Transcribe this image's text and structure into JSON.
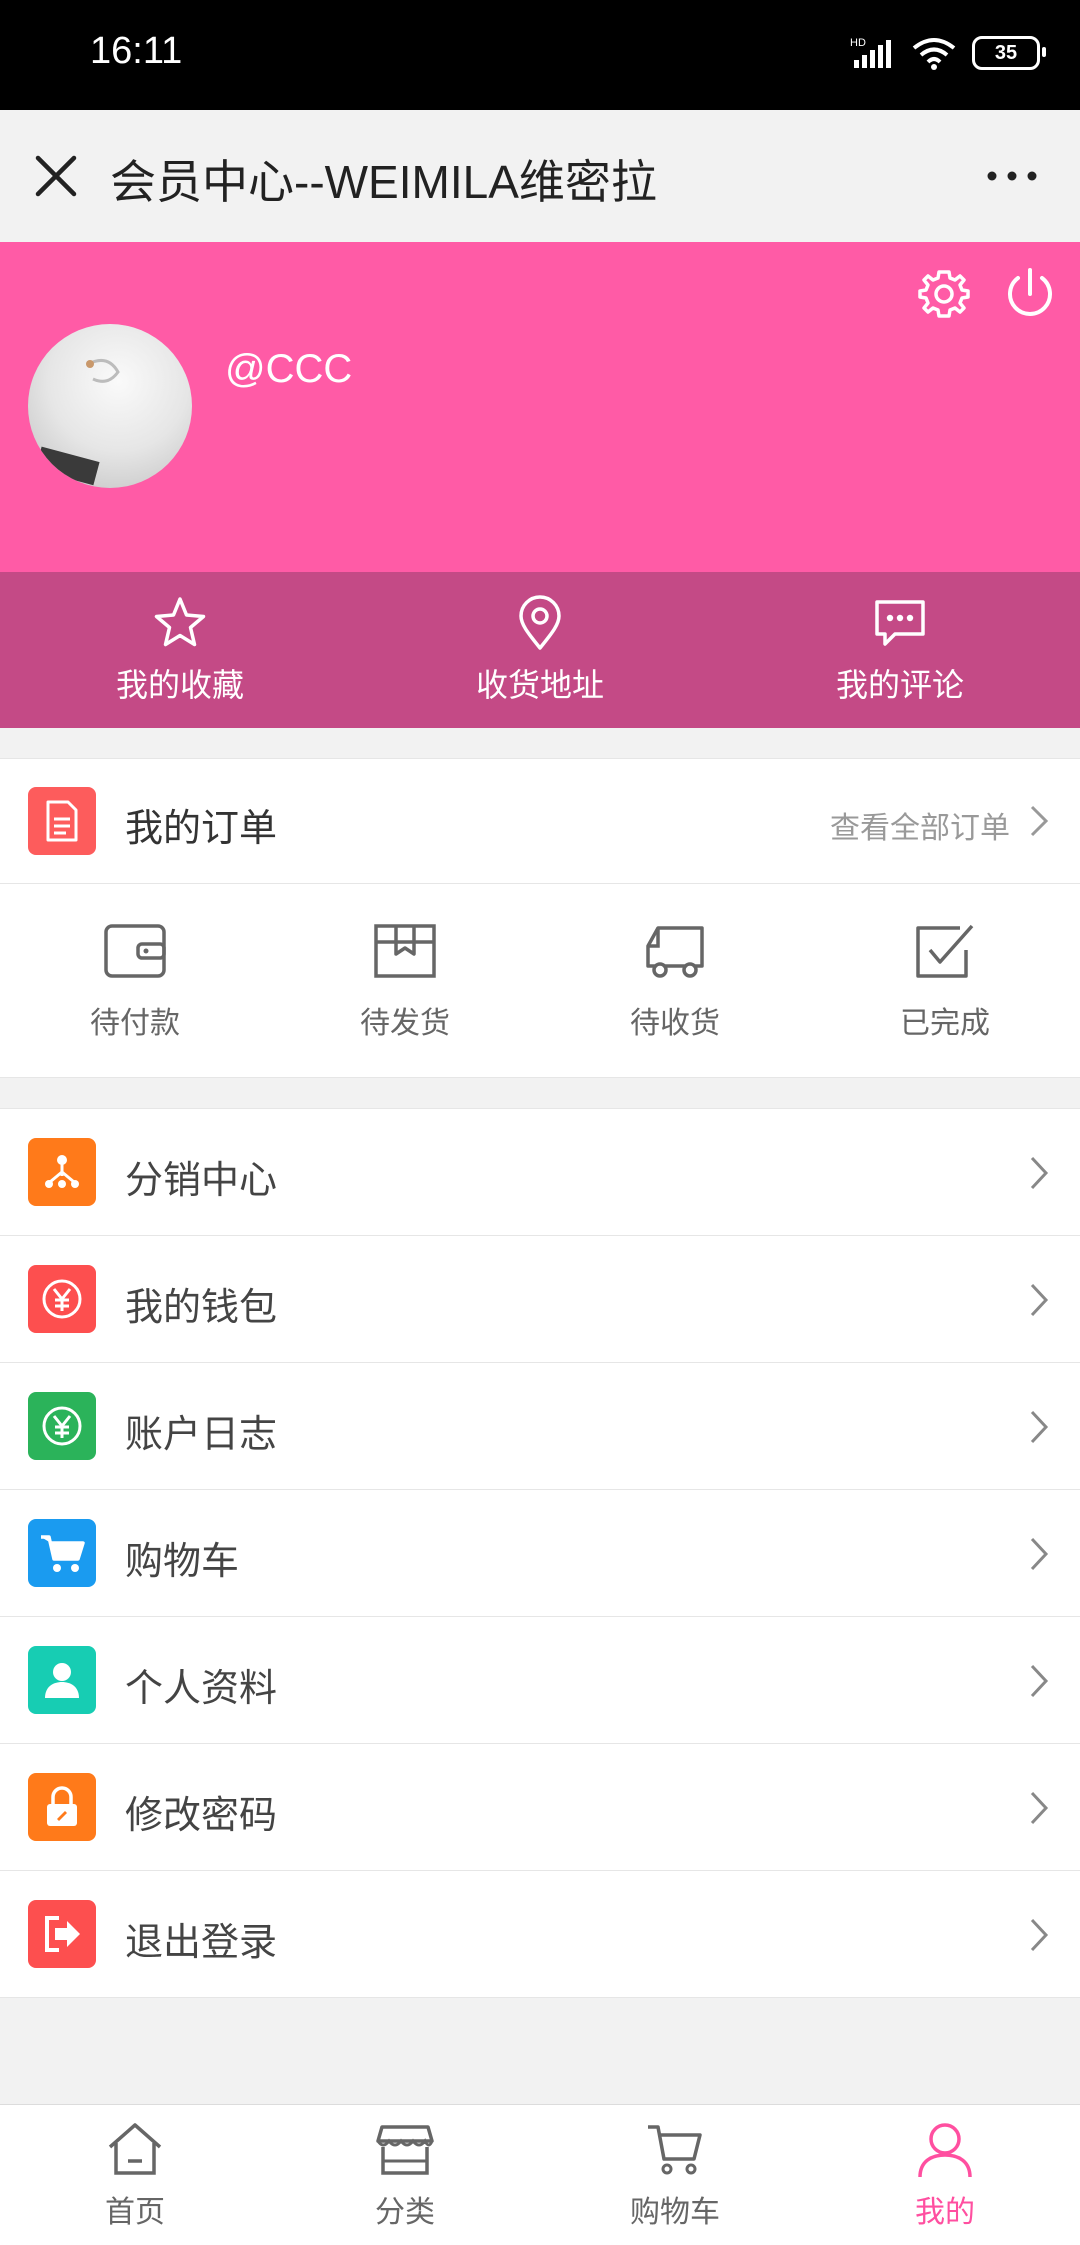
{
  "status_bar": {
    "time": "16:11",
    "network": "HD",
    "battery": "35"
  },
  "title_bar": {
    "title": "会员中心--WEIMILA维密拉"
  },
  "profile": {
    "username": "@CCC"
  },
  "quick_links": [
    {
      "label": "我的收藏",
      "icon": "star-icon"
    },
    {
      "label": "收货地址",
      "icon": "location-pin-icon"
    },
    {
      "label": "我的评论",
      "icon": "comment-icon"
    }
  ],
  "orders": {
    "title": "我的订单",
    "view_all": "查看全部订单",
    "statuses": [
      {
        "label": "待付款",
        "icon": "wallet-icon"
      },
      {
        "label": "待发货",
        "icon": "package-icon"
      },
      {
        "label": "待收货",
        "icon": "truck-icon"
      },
      {
        "label": "已完成",
        "icon": "checkbox-icon"
      }
    ]
  },
  "menu": [
    {
      "label": "分销中心",
      "icon": "network-icon",
      "color": "#ff7a1a"
    },
    {
      "label": "我的钱包",
      "icon": "yuan-icon",
      "color": "#fd4f4f"
    },
    {
      "label": "账户日志",
      "icon": "yuan-icon",
      "color": "#2bb35a"
    },
    {
      "label": "购物车",
      "icon": "cart-icon",
      "color": "#1a9bf0"
    },
    {
      "label": "个人资料",
      "icon": "user-icon",
      "color": "#17cdb3"
    },
    {
      "label": "修改密码",
      "icon": "lock-icon",
      "color": "#ff7a1a"
    },
    {
      "label": "退出登录",
      "icon": "logout-icon",
      "color": "#fd4f4f"
    }
  ],
  "tab_bar": [
    {
      "label": "首页",
      "icon": "home-icon",
      "active": false
    },
    {
      "label": "分类",
      "icon": "shop-icon",
      "active": false
    },
    {
      "label": "购物车",
      "icon": "cart-icon",
      "active": false
    },
    {
      "label": "我的",
      "icon": "user-icon",
      "active": true
    }
  ],
  "colors": {
    "brand_pink": "#ff5ba6",
    "quick_bar": "#c44a86",
    "active_tab": "#ff4fa0"
  }
}
